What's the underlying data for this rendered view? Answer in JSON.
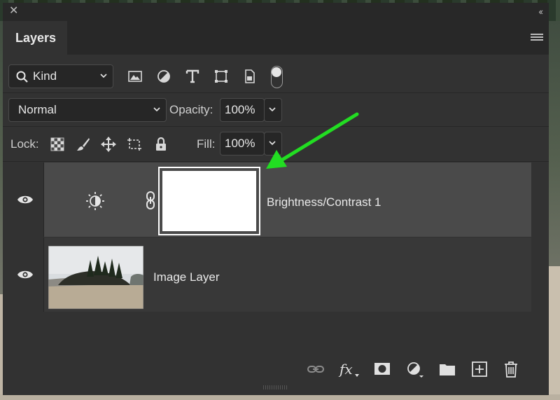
{
  "panel": {
    "tab_label": "Layers",
    "close_glyph": "✕",
    "collapse_glyph": "‹‹"
  },
  "filter": {
    "kind_label": "Kind",
    "icons": [
      "pixel-filter-icon",
      "adjustment-filter-icon",
      "type-filter-icon",
      "shape-filter-icon",
      "smart-object-filter-icon",
      "filter-toggle-switch"
    ]
  },
  "blend": {
    "mode": "Normal",
    "opacity_label": "Opacity:",
    "opacity_value": "100%"
  },
  "lock": {
    "label": "Lock:",
    "icons": [
      "lock-transparent-pixels-icon",
      "lock-image-pixels-icon",
      "lock-position-icon",
      "lock-artboard-icon",
      "lock-all-icon"
    ],
    "fill_label": "Fill:",
    "fill_value": "100%"
  },
  "layers": [
    {
      "name": "Brightness/Contrast 1",
      "type": "adjustment",
      "selected": true,
      "visible": true
    },
    {
      "name": "Image Layer",
      "type": "image",
      "selected": false,
      "visible": true
    }
  ],
  "footer_icons": [
    "link-layers-icon",
    "fx-icon",
    "add-mask-icon",
    "new-adjustment-icon",
    "new-group-icon",
    "new-layer-icon",
    "delete-layer-icon"
  ],
  "footer_fx_label": "fx",
  "colors": {
    "panel_bg": "#323232",
    "selected_row": "#4a4a4a",
    "annotation_arrow": "#22dd22"
  }
}
